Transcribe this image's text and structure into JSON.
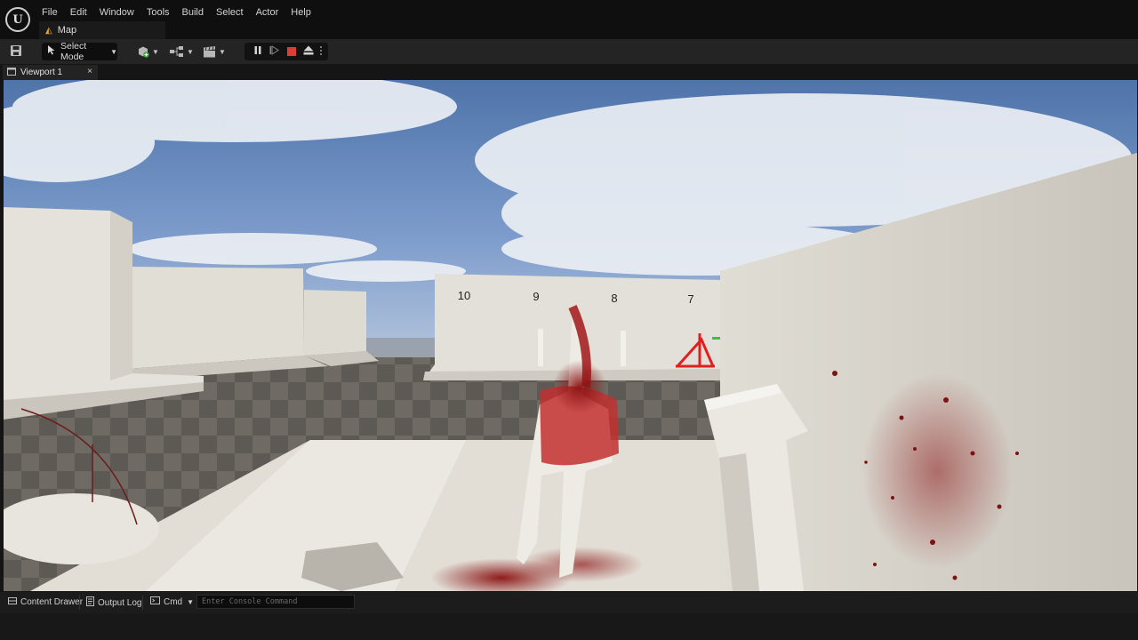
{
  "app": {
    "logo_letter": "U"
  },
  "menu": [
    "File",
    "Edit",
    "Window",
    "Tools",
    "Build",
    "Select",
    "Actor",
    "Help"
  ],
  "level_tab": {
    "label": "Map",
    "icon": "level-icon"
  },
  "toolbar": {
    "save_icon": "save-icon",
    "select_mode_label": "Select Mode",
    "play_controls": [
      "pause-icon",
      "frame-skip-icon",
      "stop-icon",
      "eject-icon",
      "more-options-icon"
    ],
    "stop_color": "#e03b3b"
  },
  "viewport_tab": {
    "label": "Viewport 1",
    "close": "×"
  },
  "scene": {
    "distance_markers": [
      "10",
      "9",
      "8",
      "7"
    ]
  },
  "statusbar": {
    "content_drawer": "Content Drawer",
    "output_log": "Output Log",
    "cmd": "Cmd",
    "console_placeholder": "Enter Console Command"
  }
}
